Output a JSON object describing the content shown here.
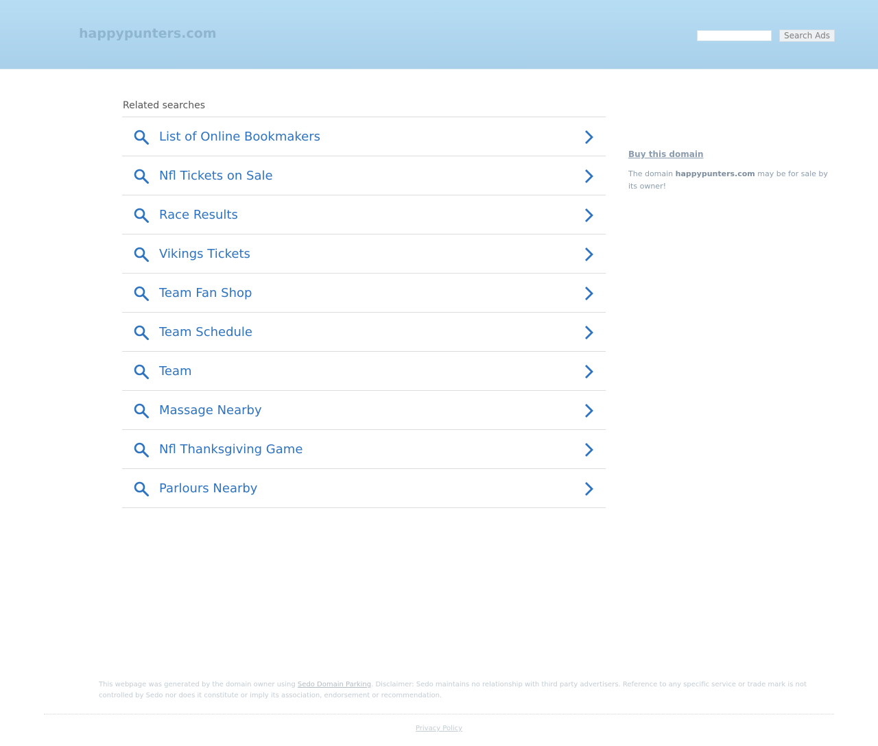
{
  "header": {
    "site_name": "happypunters.com",
    "search": {
      "value": "",
      "placeholder": "",
      "button_label": "Search Ads"
    }
  },
  "related": {
    "title": "Related searches",
    "items": [
      {
        "label": "List of Online Bookmakers"
      },
      {
        "label": "Nfl Tickets on Sale"
      },
      {
        "label": "Race Results"
      },
      {
        "label": "Vikings Tickets"
      },
      {
        "label": "Team Fan Shop"
      },
      {
        "label": "Team Schedule"
      },
      {
        "label": "Team"
      },
      {
        "label": "Massage Nearby"
      },
      {
        "label": "Nfl Thanksgiving Game"
      },
      {
        "label": "Parlours Nearby"
      }
    ],
    "item_icon": "search-icon",
    "item_arrow_icon": "chevron-right-icon"
  },
  "sidebar": {
    "buy_link": "Buy this domain",
    "text_before": "The domain ",
    "domain": "happypunters.com",
    "text_after": " may be for sale by its owner!"
  },
  "footer": {
    "disclaimer_before": "This webpage was generated by the domain owner using ",
    "disclaimer_link": "Sedo Domain Parking",
    "disclaimer_after": ". Disclaimer: Sedo maintains no relationship with third party advertisers. Reference to any specific service or trade mark is not controlled by Sedo nor does it constitute or imply its association, endorsement or recommendation.",
    "privacy_label": "Privacy Policy"
  },
  "colors": {
    "header_top": "#b6ddf3",
    "header_bottom": "#a9d0ea",
    "link_blue": "#2e73c0",
    "muted_text": "#8b9cae"
  }
}
